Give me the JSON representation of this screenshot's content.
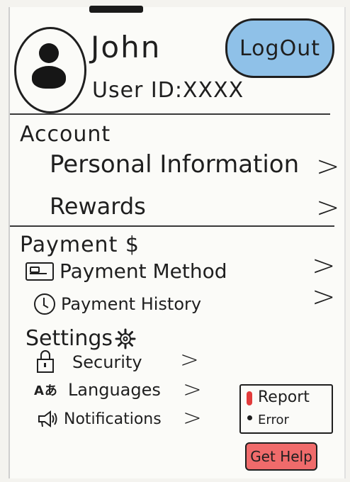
{
  "profile": {
    "name": "John",
    "user_id": "User ID:XXXX",
    "logout_label": "LogOut"
  },
  "account": {
    "title": "Account",
    "items": [
      {
        "label": "Personal Information",
        "icon": "chevron-right-icon"
      },
      {
        "label": "Rewards",
        "icon": "chevron-right-icon"
      }
    ]
  },
  "payment": {
    "title": "Payment $",
    "items": [
      {
        "label": "Payment Method",
        "icon": "credit-card-icon"
      },
      {
        "label": "Payment History",
        "icon": "clock-icon"
      }
    ]
  },
  "settings": {
    "title": "Settings",
    "items": [
      {
        "label": "Security",
        "icon": "lock-icon"
      },
      {
        "label": "Languages",
        "icon": "language-icon"
      },
      {
        "label": "Notifications",
        "icon": "megaphone-icon"
      }
    ]
  },
  "actions": {
    "report_line1": "Report",
    "report_line2": "Error",
    "get_help": "Get Help"
  },
  "glyphs": {
    "chevron": ">",
    "language": "Aあ"
  },
  "colors": {
    "logout_bg": "#8fc1e8",
    "get_help_bg": "#f06b6b",
    "report_marker": "#e23b3b"
  }
}
